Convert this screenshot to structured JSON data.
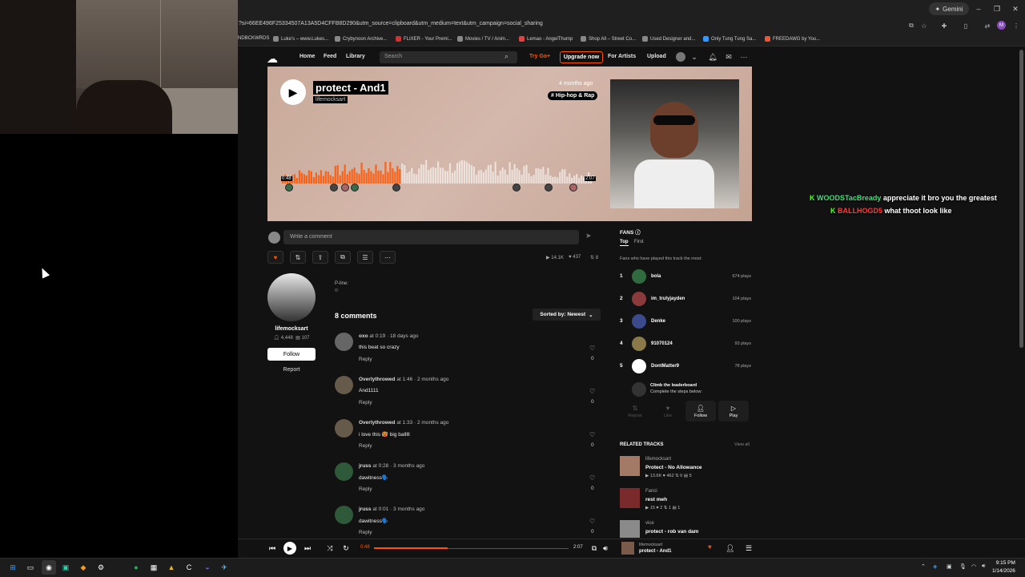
{
  "browser": {
    "gemini_label": "Gemini",
    "url": "?si=66EE496F25334507A13A5D4CFFB8D290&utm_source=clipboard&utm_medium=text&utm_campaign=social_sharing",
    "bookmarks": [
      {
        "label": "NDBCKWRDS"
      },
      {
        "label": "Luke's – www.Lukes..."
      },
      {
        "label": "Crybynoon Archive..."
      },
      {
        "label": "FLIXER - Your Premi..."
      },
      {
        "label": "Movies / TV / Anim..."
      },
      {
        "label": "Lemao - AngelThump"
      },
      {
        "label": "Shop All – Street Co..."
      },
      {
        "label": "Used Designer and..."
      },
      {
        "label": "Only Tung Tung Sa..."
      },
      {
        "label": "FREEDAWG by You..."
      }
    ],
    "profile_initial": "M"
  },
  "header": {
    "nav": [
      "Home",
      "Feed",
      "Library"
    ],
    "search_placeholder": "Search",
    "try_go": "Try Go+",
    "upgrade": "Upgrade now",
    "for_artists": "For Artists",
    "upload": "Upload"
  },
  "track": {
    "title": "protect - And1",
    "artist": "lifemocksart",
    "posted": "4 months ago",
    "genre": "# Hip-hop & Rap",
    "time_elapsed_wave": "0:48",
    "duration_wave": "2:07",
    "progress": 0.378,
    "plays": "14.1K",
    "likes": "437",
    "reposts": "8"
  },
  "comment_input": {
    "placeholder": "Write a comment"
  },
  "artist_panel": {
    "name": "lifemocksart",
    "followers": "4,448",
    "tracks": "107",
    "follow": "Follow",
    "report": "Report"
  },
  "pline": {
    "label": "P-line:",
    "value": "℗"
  },
  "comments": {
    "count_label": "8 comments",
    "sort_label": "Sorted by: Newest",
    "reply_label": "Reply",
    "items": [
      {
        "user": "oxo",
        "at": "at 0:19",
        "ago": " · 18 days ago",
        "text": "this beat so crazy",
        "likes": "0"
      },
      {
        "user": "Overlythrowed",
        "at": "at 1:46",
        "ago": " · 2 months ago",
        "text": "And1111",
        "likes": "0"
      },
      {
        "user": "Overlythrowed",
        "at": "at 1:33",
        "ago": " · 2 months ago",
        "text": "i love this 🥵 big balllll",
        "likes": "0"
      },
      {
        "user": "jruss",
        "at": "at 0:28",
        "ago": " · 3 months ago",
        "text": "dawitness🗣️",
        "likes": "0"
      },
      {
        "user": "jruss",
        "at": "at 0:01",
        "ago": " · 3 months ago",
        "text": "dawitness🗣️",
        "likes": "0"
      }
    ]
  },
  "fans": {
    "title": "FANS",
    "tab_top": "Top",
    "tab_first": "First",
    "subtitle": "Fans who have played this track the most:",
    "items": [
      {
        "rank": "1",
        "name": "bola",
        "plays": "674 plays"
      },
      {
        "rank": "2",
        "name": "im_trulyjayden",
        "plays": "104 plays"
      },
      {
        "rank": "3",
        "name": "Denke",
        "plays": "100 plays"
      },
      {
        "rank": "4",
        "name": "91070124",
        "plays": "93 plays"
      },
      {
        "rank": "5",
        "name": "DontMatter9",
        "plays": "78 plays"
      }
    ],
    "climb_title": "Climb the leaderboard",
    "climb_sub": "Complete the steps below:",
    "steps": [
      "Repost",
      "Like",
      "Follow",
      "Play"
    ]
  },
  "related": {
    "title": "RELATED TRACKS",
    "view_all": "View all",
    "items": [
      {
        "artist": "lifemocksart",
        "title": "Protect - No Allowance",
        "stats": "▶ 13.6K  ♥ 462  ⇅ 6  ▤ 5"
      },
      {
        "artist": "Fanci",
        "title": "rest meh",
        "stats": "▶ 15  ♥ 2  ⇅ 1  ▤ 1"
      },
      {
        "artist": "vice",
        "title": "protect - rob van dam",
        "stats": ""
      }
    ]
  },
  "chat": [
    {
      "user": "WOODSTacBready",
      "message": "appreciate it bro you the greatest",
      "color": "#3fe07a"
    },
    {
      "user": "BALLHOGD5",
      "message": "what thoot look like",
      "color": "#ff3b3b"
    }
  ],
  "player": {
    "elapsed": "0:48",
    "duration": "2:07",
    "progress": 0.378,
    "artist": "lifemocksart",
    "title": "protect - And1"
  },
  "taskbar": {
    "time": "9:15 PM",
    "date": "1/14/2026"
  },
  "colors": {
    "accent": "#ff5500"
  }
}
